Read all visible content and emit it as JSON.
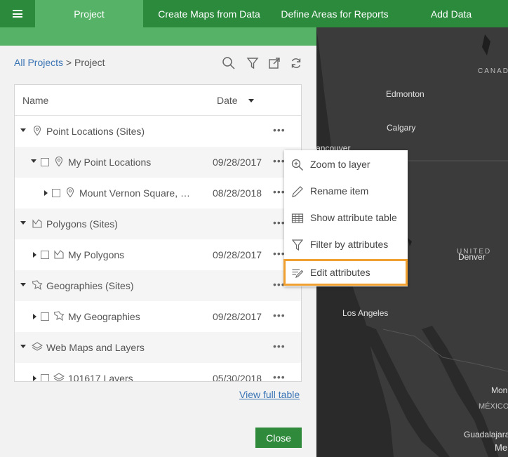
{
  "nav": {
    "tabs": [
      "Project",
      "Create Maps from Data",
      "Define Areas for Reports",
      "Add Data"
    ],
    "active_tab": "Project"
  },
  "panel": {
    "breadcrumb_root": "All Projects",
    "breadcrumb_sep": " > ",
    "breadcrumb_current": "Project",
    "columns": {
      "name": "Name",
      "date": "Date"
    },
    "rows": [
      {
        "label": "Point Locations (Sites)",
        "date": "",
        "icon": "pin-icon"
      },
      {
        "label": "My Point Locations",
        "date": "09/28/2017",
        "icon": "pin-icon"
      },
      {
        "label": "Mount Vernon Square, …",
        "date": "08/28/2018",
        "icon": "pin-icon"
      },
      {
        "label": "Polygons (Sites)",
        "date": "",
        "icon": "polygon-icon"
      },
      {
        "label": "My Polygons",
        "date": "09/28/2017",
        "icon": "polygon-icon"
      },
      {
        "label": "Geographies (Sites)",
        "date": "",
        "icon": "geography-icon"
      },
      {
        "label": "My Geographies",
        "date": "09/28/2017",
        "icon": "geography-icon"
      },
      {
        "label": "Web Maps and Layers",
        "date": "",
        "icon": "layers-icon"
      },
      {
        "label": "101617 Layers",
        "date": "05/30/2018",
        "icon": "layers-icon"
      }
    ],
    "more_glyph": "•••",
    "view_full_table": "View full table",
    "close_label": "Close"
  },
  "context_menu": {
    "items": [
      {
        "label": "Zoom to layer",
        "icon": "zoom-in-icon"
      },
      {
        "label": "Rename item",
        "icon": "pencil-icon"
      },
      {
        "label": "Show attribute table",
        "icon": "table-icon"
      },
      {
        "label": "Filter by attributes",
        "icon": "filter-icon"
      },
      {
        "label": "Edit attributes",
        "icon": "edit-attributes-icon"
      }
    ],
    "highlighted": "Edit attributes"
  },
  "map": {
    "labels": {
      "canada": "CANADA",
      "edmonton": "Edmonton",
      "calgary": "Calgary",
      "vancouver": "Vancouver",
      "united": "UNITED",
      "denver": "Denver",
      "los_angeles": "Los Angeles",
      "mon": "Mon",
      "mexico": "MÉXICO",
      "guadalajara": "Guadalajara",
      "me": "Me"
    }
  },
  "colors": {
    "nav_green": "#2c8a3d",
    "active_green": "#56b267",
    "link_blue": "#3a74b5",
    "highlight_orange": "#f0a030"
  }
}
